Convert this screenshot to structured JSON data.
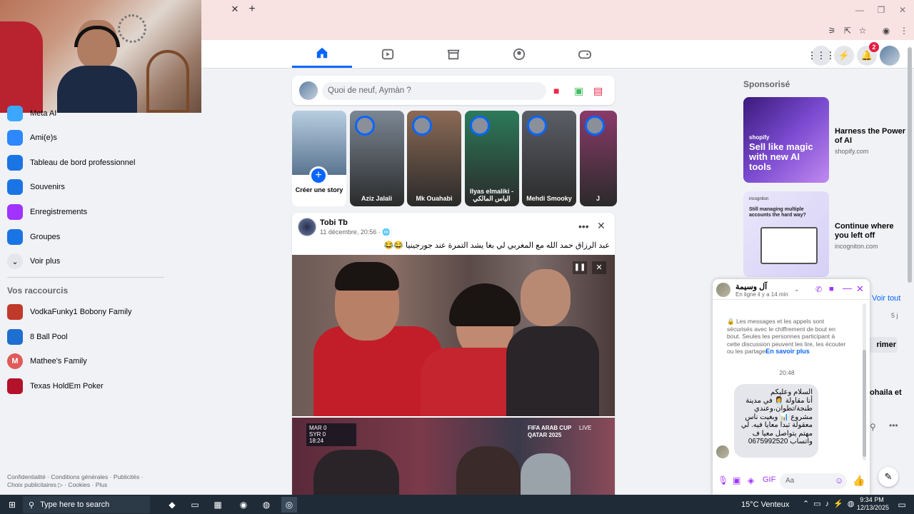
{
  "browser": {
    "tab_close": "✕",
    "new_tab": "+",
    "win_minimize": "—",
    "win_maximize": "❐",
    "win_close": "✕"
  },
  "fb": {
    "notification_count": "2",
    "composer_placeholder": "Quoi de neuf, Aymàn ?",
    "accent": "#0866ff"
  },
  "sidebar": {
    "items": [
      {
        "label": "Meta AI",
        "icon": "meta-ai-icon",
        "color": "#3ba7ff"
      },
      {
        "label": "Ami(e)s",
        "icon": "friends-icon",
        "color": "#2d88ff"
      },
      {
        "label": "Tableau de bord professionnel",
        "icon": "dashboard-icon",
        "color": "#1b74e4"
      },
      {
        "label": "Souvenirs",
        "icon": "memories-icon",
        "color": "#1b74e4"
      },
      {
        "label": "Enregistrements",
        "icon": "bookmark-icon",
        "color": "#a033ff"
      },
      {
        "label": "Groupes",
        "icon": "groups-icon",
        "color": "#1b74e4"
      },
      {
        "label": "Voir plus",
        "icon": "chevron-down-icon",
        "color": "#e4e6eb"
      }
    ],
    "shortcuts_title": "Vos raccourcis",
    "shortcuts": [
      {
        "label": "VodkaFunky1 Bobony Family",
        "color": "#c0392b"
      },
      {
        "label": "8 Ball Pool",
        "color": "#1f6fd1"
      },
      {
        "label": "Mathee's Family",
        "color": "#e05a5a",
        "letter": "M"
      },
      {
        "label": "Texas HoldEm Poker",
        "color": "#b3122a"
      }
    ],
    "footer_line1": "Confidentialité · Conditions générales · Publicités ·",
    "footer_line2": "Choix publicitaires ▷ · Cookies · Plus"
  },
  "stories": [
    {
      "name": "Créer une story",
      "color": "#6d8ba8",
      "create": true
    },
    {
      "name": "Aziz Jalali",
      "color": "#7b8794"
    },
    {
      "name": "Mk Ouahabi",
      "color": "#8b6a55"
    },
    {
      "name": "Ilyas elmaliki - الياس المالكي",
      "color": "#2c7a5a"
    },
    {
      "name": "Mehdi Smooky",
      "color": "#5b5e66"
    },
    {
      "name": "J",
      "color": "#8a3a6a"
    }
  ],
  "post": {
    "author": "Tobi Tb",
    "time": "11 décembre, 20:56 · 🌐",
    "text": "عبد الرزاق حمد الله مع المغربي لي بغا يشد التمرة عند جورجينيا 😂😂",
    "overlay_left": "MAR 0",
    "overlay_left2": "SYR 0",
    "overlay_clock": "18:24",
    "overlay_right": "FIFA ARAB CUP QATAR 2025",
    "overlay_live": "LIVE"
  },
  "ads": {
    "title": "Sponsorisé",
    "items": [
      {
        "headline": "Harness the Power of AI",
        "domain": "shopify.com",
        "image_text": "Sell like magic with new AI tools",
        "brand": "shopify"
      },
      {
        "headline": "Continue where you left off",
        "domain": "incogniton.com",
        "image_text": "Still managing multiple accounts the hard way?",
        "brand": "incogniton"
      }
    ],
    "behind_voir_tout": "Voir tout",
    "behind_5j": "5 j",
    "behind_rimer": "rimer",
    "behind_name": "lohaila et"
  },
  "chat": {
    "name": "آل وسيمة",
    "status": "En ligne il y a 14 min",
    "security_text": "Les messages et les appels sont sécurisés avec le chiffrement de bout en bout. Seules les personnes participant à cette discussion peuvent les lire, les écouter ou les partager.",
    "learn_more": "En savoir plus",
    "time": "20:48",
    "message": "السلام وعليكم\nأنا مقاولة 👩‍💼 في مدينة طنجة/تطوان،وعندي مشروع 📊 وبغيت ناس معقولة تبدا معايا فيه. لي مهتم يتواصل معيا ف واتساب 0675992520",
    "input_placeholder": "Aa"
  },
  "taskbar": {
    "search_placeholder": "Type here to search",
    "weather": "15°C  Venteux",
    "time": "9:34 PM",
    "date": "12/13/2025"
  }
}
